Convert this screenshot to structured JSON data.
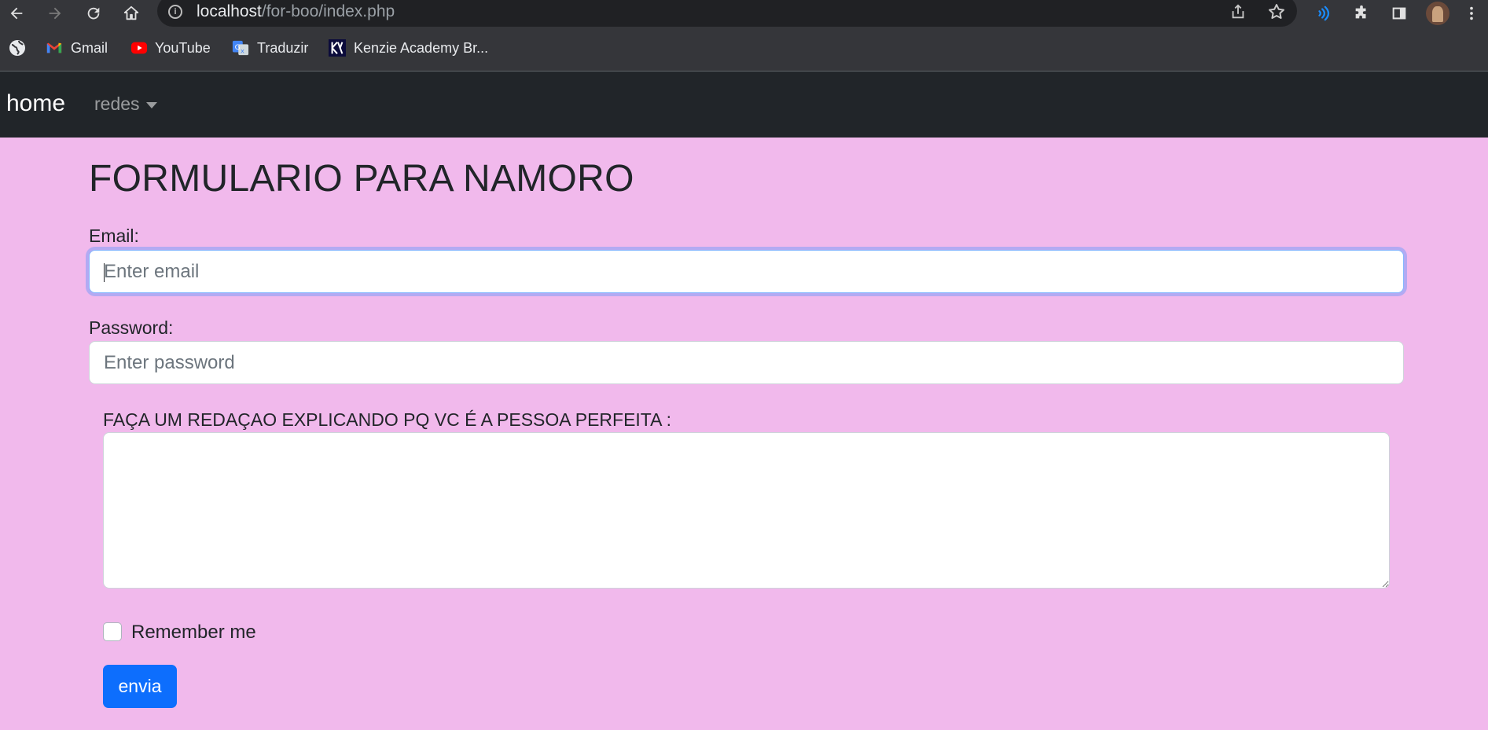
{
  "browser": {
    "url_host": "localhost",
    "url_path": "/for-boo/index.php",
    "bookmarks": [
      {
        "label": "Gmail",
        "icon": "gmail-icon"
      },
      {
        "label": "YouTube",
        "icon": "youtube-icon"
      },
      {
        "label": "Traduzir",
        "icon": "google-translate-icon"
      },
      {
        "label": "Kenzie Academy Br...",
        "icon": "kenzie-academy-icon"
      }
    ]
  },
  "navbar": {
    "brand": "home",
    "dropdown_label": "redes"
  },
  "form": {
    "title": "FORMULARIO PARA NAMORO",
    "email_label": "Email:",
    "email_placeholder": "Enter email",
    "password_label": "Password:",
    "password_placeholder": "Enter password",
    "essay_label": "FAÇA UM REDAÇAO EXPLICANDO PQ VC É A PESSOA PERFEITA :",
    "remember_label": "Remember me",
    "submit_label": "envia"
  },
  "colors": {
    "page_background": "#f1b9ec",
    "navbar_background": "#212529",
    "button_primary": "#0d6efd",
    "focus_ring": "#b3aaf3"
  }
}
